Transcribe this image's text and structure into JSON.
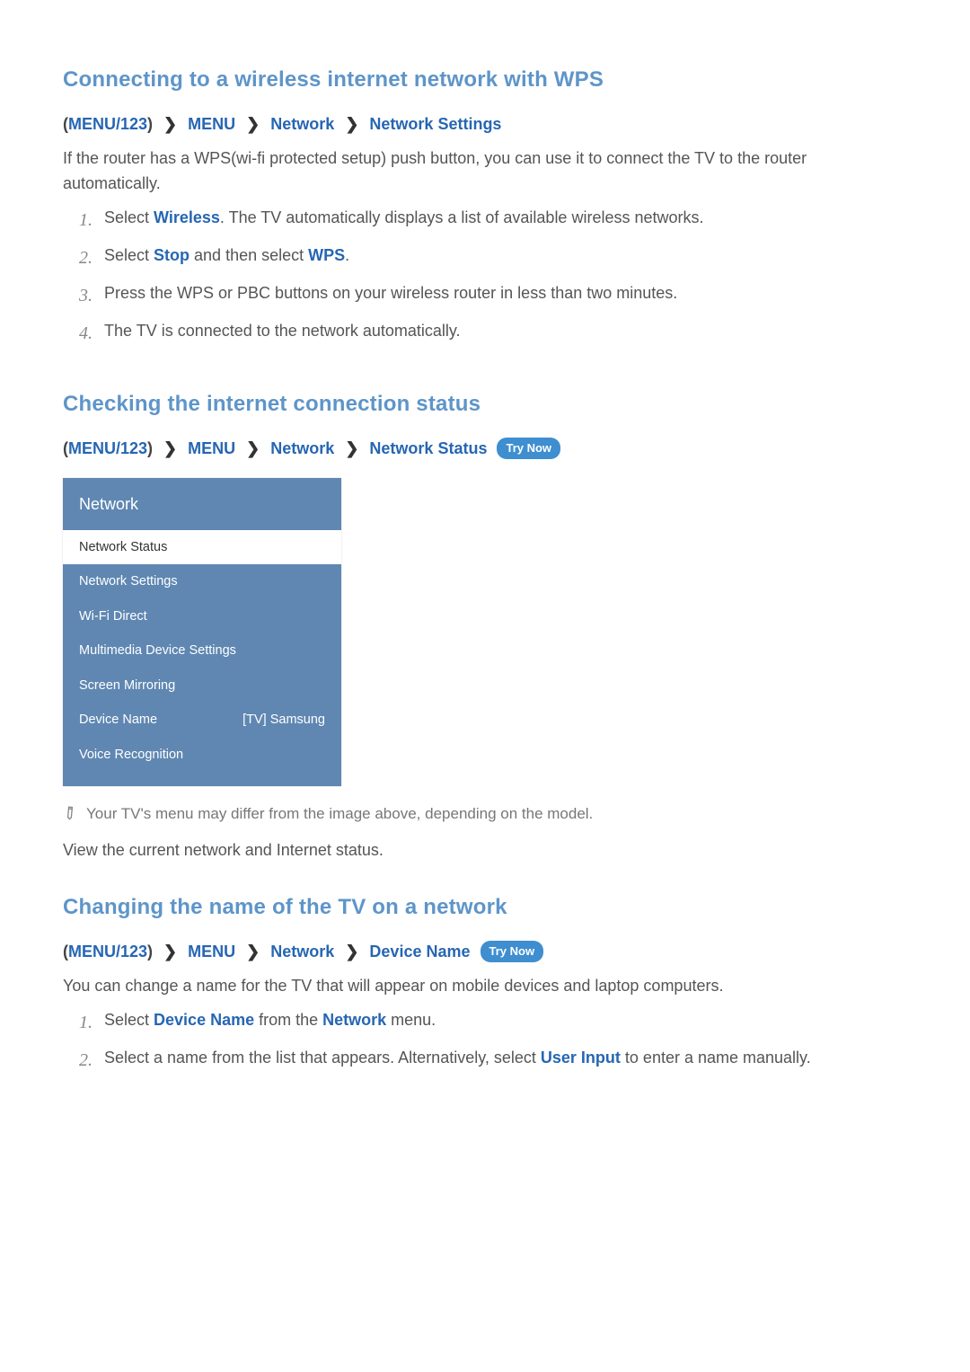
{
  "sections": [
    {
      "title": "Connecting to a wireless internet network with WPS",
      "crumb": [
        "MENU/123",
        "MENU",
        "Network",
        "Network Settings"
      ],
      "tryNow": false,
      "intro_parts": [
        "If the router has a WPS(wi-fi protected setup) push button, you can use it to connect the TV to the router automatically."
      ],
      "steps": [
        [
          {
            "t": "Select "
          },
          {
            "t": "Wireless",
            "hl": true
          },
          {
            "t": ". The TV automatically displays a list of available wireless networks."
          }
        ],
        [
          {
            "t": "Select "
          },
          {
            "t": "Stop",
            "hl": true
          },
          {
            "t": " and then select "
          },
          {
            "t": "WPS",
            "hl": true
          },
          {
            "t": "."
          }
        ],
        [
          {
            "t": "Press the WPS or PBC buttons on your wireless router in less than two minutes."
          }
        ],
        [
          {
            "t": "The TV is connected to the network automatically."
          }
        ]
      ]
    },
    {
      "title": "Checking the internet connection status",
      "crumb": [
        "MENU/123",
        "MENU",
        "Network",
        "Network Status"
      ],
      "tryNow": true,
      "tryNowLabel": "Try Now",
      "menuBox": {
        "title": "Network",
        "rows": [
          {
            "label": "Network Status",
            "selected": true
          },
          {
            "label": "Network Settings"
          },
          {
            "label": "Wi-Fi Direct"
          },
          {
            "label": "Multimedia Device Settings"
          },
          {
            "label": "Screen Mirroring"
          },
          {
            "label": "Device Name",
            "value": "[TV] Samsung"
          },
          {
            "label": "Voice Recognition"
          }
        ]
      },
      "note": "Your TV's menu may differ from the image above, depending on the model.",
      "post": "View the current network and Internet status."
    },
    {
      "title": "Changing the name of the TV on a network",
      "crumb": [
        "MENU/123",
        "MENU",
        "Network",
        "Device Name"
      ],
      "tryNow": true,
      "tryNowLabel": "Try Now",
      "intro_parts": [
        "You can change a name for the TV that will appear on mobile devices and laptop computers."
      ],
      "steps": [
        [
          {
            "t": "Select "
          },
          {
            "t": "Device Name",
            "hl": true
          },
          {
            "t": " from the "
          },
          {
            "t": "Network",
            "hl": true
          },
          {
            "t": " menu."
          }
        ],
        [
          {
            "t": "Select a name from the list that appears. Alternatively, select "
          },
          {
            "t": "User Input",
            "hl": true
          },
          {
            "t": " to enter a name manually."
          }
        ]
      ]
    }
  ]
}
